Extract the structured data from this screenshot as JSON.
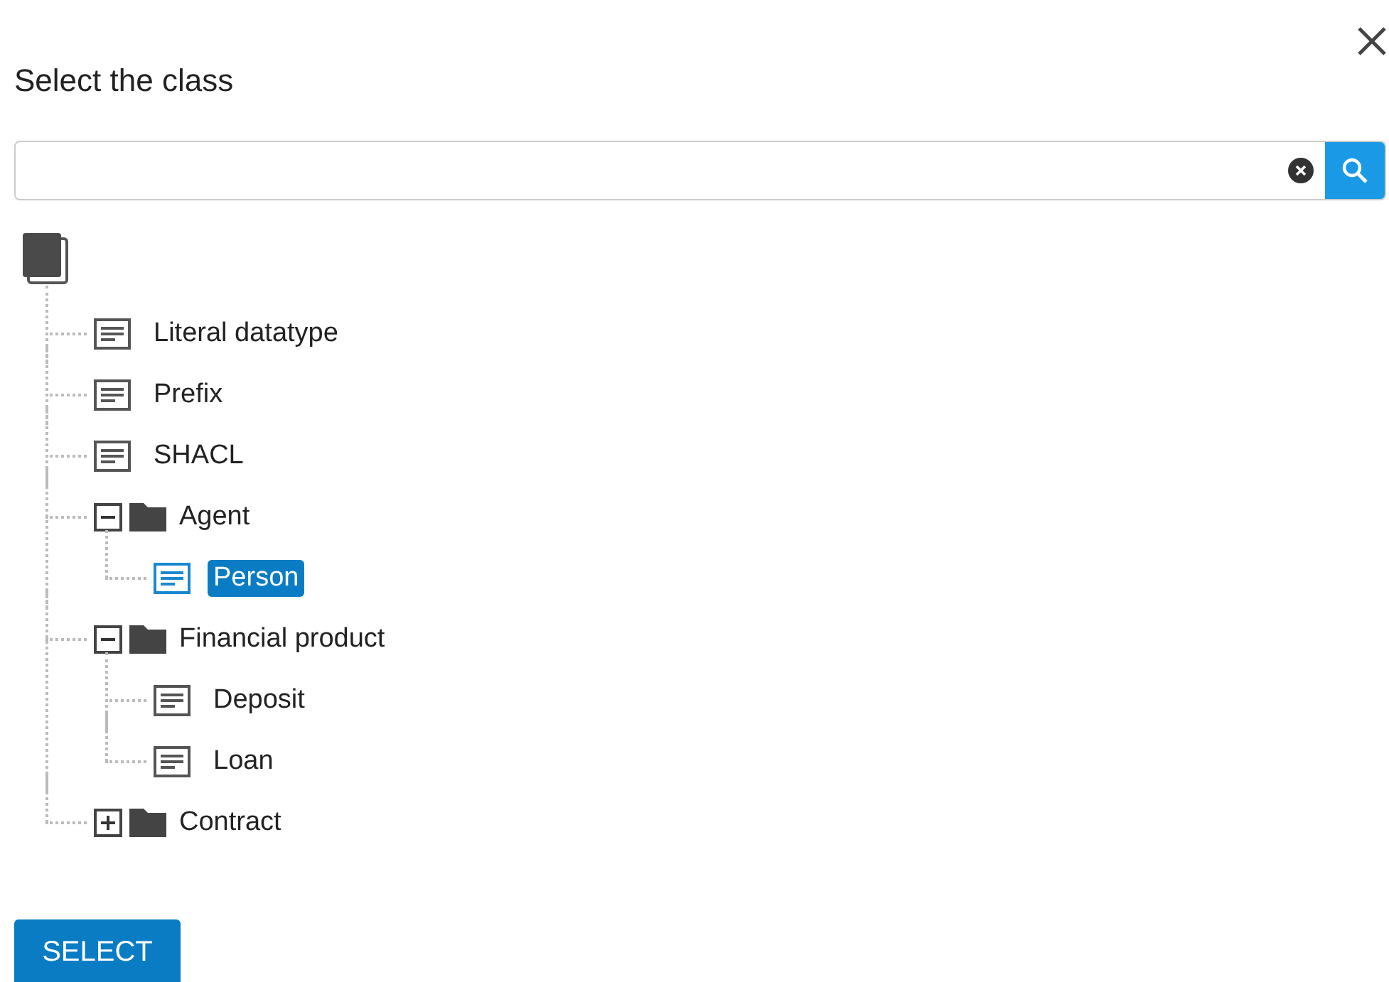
{
  "dialog": {
    "title": "Select the class"
  },
  "tree": {
    "items": [
      {
        "kind": "class",
        "label": "Literal datatype",
        "selected": false
      },
      {
        "kind": "class",
        "label": "Prefix",
        "selected": false
      },
      {
        "kind": "class",
        "label": "SHACL",
        "selected": false
      },
      {
        "kind": "folder",
        "label": "Agent",
        "expanded": true,
        "children": [
          {
            "kind": "class",
            "label": "Person",
            "selected": true
          }
        ]
      },
      {
        "kind": "folder",
        "label": "Financial product",
        "expanded": true,
        "children": [
          {
            "kind": "class",
            "label": "Deposit",
            "selected": false
          },
          {
            "kind": "class",
            "label": "Loan",
            "selected": false
          }
        ]
      },
      {
        "kind": "folder",
        "label": "Contract",
        "expanded": false
      }
    ]
  },
  "footer": {
    "button": "SELECT"
  }
}
